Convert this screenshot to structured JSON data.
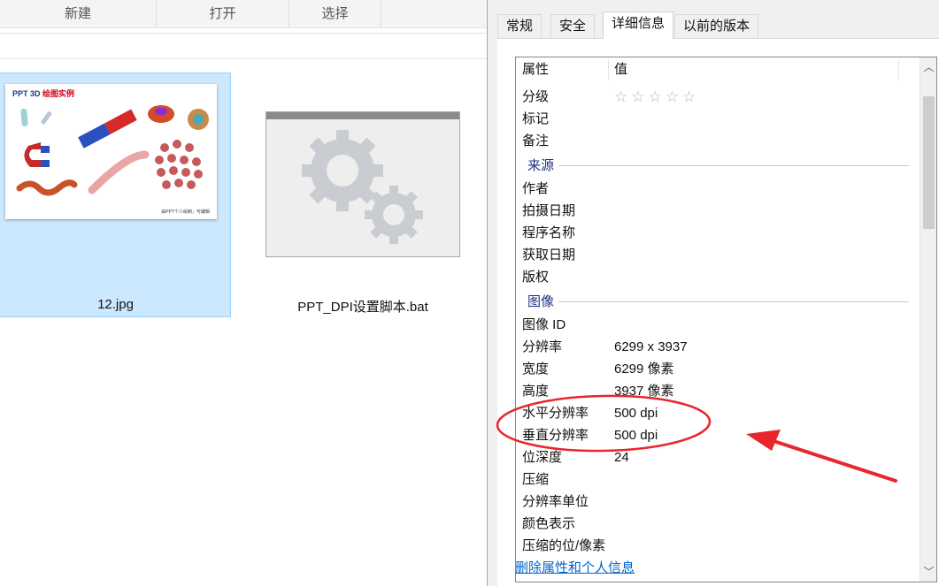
{
  "ribbon": {
    "groups": [
      "新建",
      "打开",
      "选择"
    ]
  },
  "files": [
    {
      "name": "12.jpg",
      "thumb_title_prefix": "PPT 3D ",
      "thumb_title_red": "绘图实例",
      "thumb_footer": "由PPT个人绘制，可编辑"
    },
    {
      "name": "PPT_DPI设置脚本.bat"
    }
  ],
  "dialog": {
    "tabs": [
      "常规",
      "安全",
      "详细信息",
      "以前的版本"
    ],
    "active_tab": "详细信息",
    "header": {
      "property": "属性",
      "value": "值"
    },
    "rating_stars": "☆☆☆☆☆",
    "rows_top": [
      {
        "name": "分级",
        "value": ""
      },
      {
        "name": "标记",
        "value": ""
      },
      {
        "name": "备注",
        "value": ""
      }
    ],
    "groups": [
      "来源",
      "图像"
    ],
    "source_rows": [
      {
        "name": "作者",
        "value": ""
      },
      {
        "name": "拍摄日期",
        "value": ""
      },
      {
        "name": "程序名称",
        "value": ""
      },
      {
        "name": "获取日期",
        "value": ""
      },
      {
        "name": "版权",
        "value": ""
      }
    ],
    "image_rows": [
      {
        "name": "图像 ID",
        "value": ""
      },
      {
        "name": "分辨率",
        "value": "6299 x 3937"
      },
      {
        "name": "宽度",
        "value": "6299 像素"
      },
      {
        "name": "高度",
        "value": "3937 像素"
      },
      {
        "name": "水平分辨率",
        "value": "500 dpi"
      },
      {
        "name": "垂直分辨率",
        "value": "500 dpi"
      },
      {
        "name": "位深度",
        "value": "24"
      },
      {
        "name": "压缩",
        "value": ""
      },
      {
        "name": "分辨率单位",
        "value": ""
      },
      {
        "name": "颜色表示",
        "value": ""
      },
      {
        "name": "压缩的位/像素",
        "value": ""
      }
    ],
    "scroll_up": "︿",
    "scroll_down": "﹀",
    "remove_link": "删除属性和个人信息"
  },
  "colors": {
    "selection": "#cce8ff",
    "group_label": "#1e3287",
    "link": "#0066cc",
    "annotation_red": "#e8262b"
  }
}
